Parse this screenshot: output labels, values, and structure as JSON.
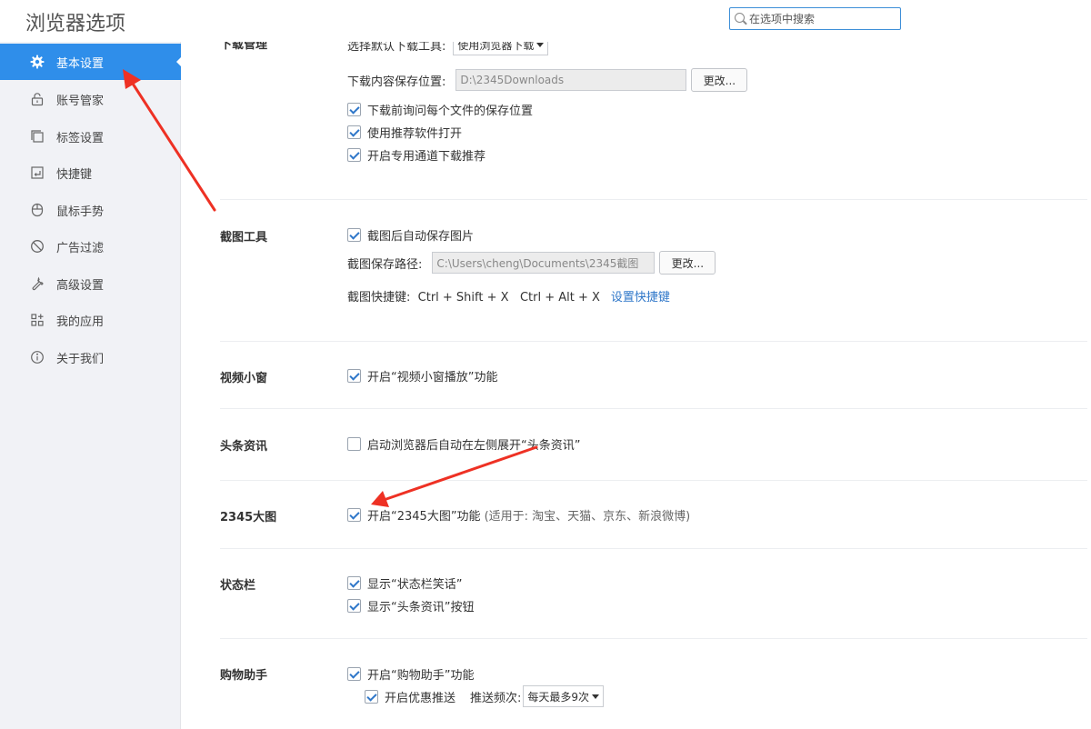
{
  "app": {
    "title": "浏览器选项"
  },
  "search": {
    "placeholder": "在选项中搜索"
  },
  "sidebar": {
    "items": [
      {
        "label": "基本设置",
        "icon": "gear-icon",
        "active": true
      },
      {
        "label": "账号管家",
        "icon": "lock-icon"
      },
      {
        "label": "标签设置",
        "icon": "tabs-icon"
      },
      {
        "label": "快捷键",
        "icon": "keyboard-icon"
      },
      {
        "label": "鼠标手势",
        "icon": "mouse-icon"
      },
      {
        "label": "广告过滤",
        "icon": "block-icon"
      },
      {
        "label": "高级设置",
        "icon": "wrench-icon"
      },
      {
        "label": "我的应用",
        "icon": "apps-icon"
      },
      {
        "label": "关于我们",
        "icon": "info-icon"
      }
    ]
  },
  "download": {
    "label": "下载管理",
    "tool_label": "选择默认下载工具:",
    "tool_value": "使用浏览器下载",
    "path_label": "下载内容保存位置:",
    "path_value": "D:\\2345Downloads",
    "change_label": "更改...",
    "opt1": "下载前询问每个文件的保存位置",
    "opt2": "使用推荐软件打开",
    "opt3": "开启专用通道下载推荐"
  },
  "screenshot": {
    "label": "截图工具",
    "opt1": "截图后自动保存图片",
    "path_label": "截图保存路径:",
    "path_value": "C:\\Users\\cheng\\Documents\\2345截图",
    "change_label": "更改...",
    "shortcut_text": "截图快捷键:  Ctrl + Shift + X   Ctrl + Alt + X",
    "shortcut_link": "设置快捷键"
  },
  "video": {
    "label": "视频小窗",
    "opt1": "开启“视频小窗播放”功能"
  },
  "news": {
    "label": "头条资讯",
    "opt1": "启动浏览器后自动在左侧展开“头条资讯”"
  },
  "bigpic": {
    "label": "2345大图",
    "opt1": "开启“2345大图”功能",
    "opt1_note": "(适用于: 淘宝、天猫、京东、新浪微博)"
  },
  "statusbar": {
    "label": "状态栏",
    "opt1": "显示“状态栏笑话”",
    "opt2": "显示“头条资讯”按钮"
  },
  "shopping": {
    "label": "购物助手",
    "opt1": "开启“购物助手”功能",
    "opt2": "开启优惠推送",
    "freq_label": "推送频次:",
    "freq_value": "每天最多9次"
  },
  "colors": {
    "accent": "#2f8eea",
    "arrow": "#ee3124",
    "link": "#2f77c9"
  }
}
